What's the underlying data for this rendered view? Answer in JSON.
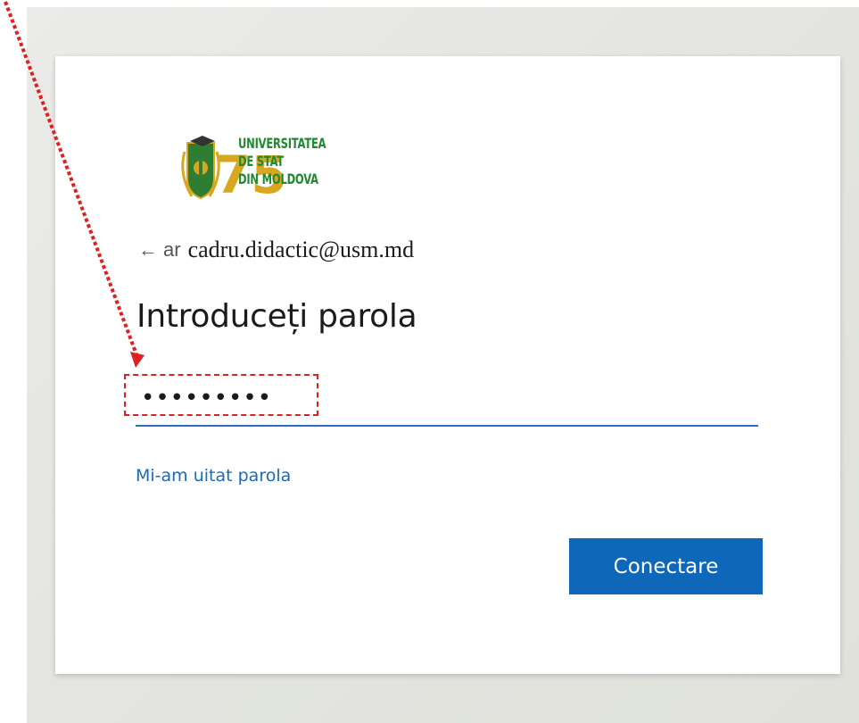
{
  "logo": {
    "lines": [
      "UNIVERSITATEA",
      "DE STAT",
      "DIN MOLDOVA"
    ],
    "number": "75"
  },
  "account": {
    "back_fragment": "ar",
    "email": "cadru.didactic@usm.md"
  },
  "heading": "Introduceți parola",
  "password": {
    "value": "•••••••••"
  },
  "forgot_link": "Mi-am uitat parola",
  "submit_button": "Conectare",
  "colors": {
    "accent_blue": "#0e67b8",
    "link_blue": "#1a6aba",
    "annotation_red": "#e02020",
    "logo_green": "#1f8a2e",
    "logo_gold": "#d9a620"
  }
}
